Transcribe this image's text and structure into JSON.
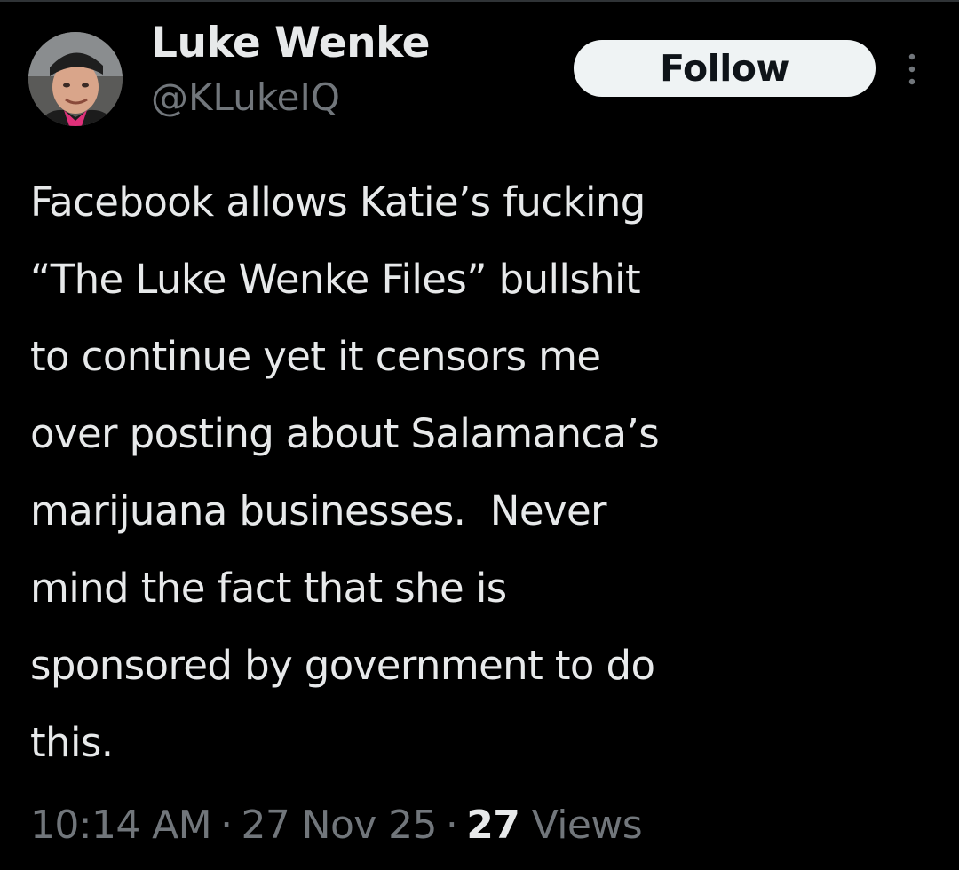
{
  "author": {
    "display_name": "Luke Wenke",
    "handle": "@KLukeIQ"
  },
  "follow_button": {
    "label": "Follow"
  },
  "more_menu": {
    "icon": "more-vertical-icon"
  },
  "tweet": {
    "lines": [
      "Facebook allows Katie’s fucking",
      "“The Luke Wenke Files” bullshit",
      "to continue yet it censors me",
      "over posting about Salamanca’s",
      "marijuana businesses.  Never",
      "mind the fact that she is",
      "sponsored by government to do",
      "this."
    ]
  },
  "meta": {
    "time": "10:14 AM",
    "separator": "·",
    "date": "27 Nov 25",
    "views_count": "27",
    "views_label": "Views"
  },
  "colors": {
    "background": "#000000",
    "text_primary": "#e7e9ea",
    "text_secondary": "#71767b",
    "button_bg": "#eff3f4",
    "button_text": "#0f1419"
  }
}
